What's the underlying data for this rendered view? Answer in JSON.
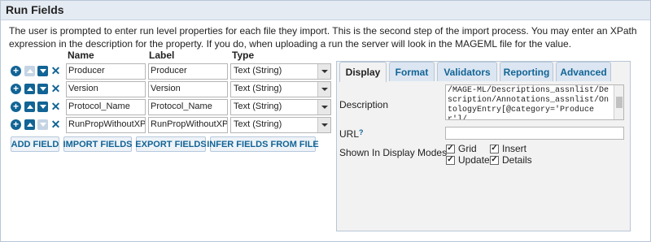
{
  "panel": {
    "title": "Run Fields"
  },
  "description": "The user is prompted to enter run level properties for each file they import. This is the second step of the import process. You may enter an XPath expression in the description for the property. If you do, when uploading a run the server will look in the MAGEML file for the value.",
  "columns": {
    "name": "Name",
    "label": "Label",
    "type": "Type"
  },
  "fields": [
    {
      "name": "Producer",
      "label": "Producer",
      "type": "Text (String)"
    },
    {
      "name": "Version",
      "label": "Version",
      "type": "Text (String)"
    },
    {
      "name": "Protocol_Name",
      "label": "Protocol_Name",
      "type": "Text (String)"
    },
    {
      "name": "RunPropWithoutXPath",
      "label": "RunPropWithoutXPath",
      "type": "Text (String)"
    }
  ],
  "buttons": {
    "add_field": "ADD FIELD",
    "import_fields": "IMPORT FIELDS",
    "export_fields": "EXPORT FIELDS",
    "infer_fields": "INFER FIELDS FROM FILE"
  },
  "tabs": [
    "Display",
    "Format",
    "Validators",
    "Reporting",
    "Advanced"
  ],
  "display": {
    "description_label": "Description",
    "description_value": "/MAGE-ML/Descriptions_assnlist/Description/Annotations_assnlist/OntologyEntry[@category='Producer']/",
    "url_label": "URL",
    "url_help": "?",
    "url_value": "",
    "shown_label": "Shown In Display Modes",
    "modes": [
      {
        "label": "Grid",
        "checked": true
      },
      {
        "label": "Insert",
        "checked": true
      },
      {
        "label": "Update",
        "checked": true
      },
      {
        "label": "Details",
        "checked": true
      }
    ]
  },
  "icons": {
    "add": "plus-circle-icon",
    "move_up": "arrow-up-icon",
    "move_down": "arrow-down-icon",
    "delete": "x-icon"
  },
  "colors": {
    "accent": "#126495",
    "header_bg": "#e5ebf3",
    "tab_bg": "#dbe6f2"
  }
}
